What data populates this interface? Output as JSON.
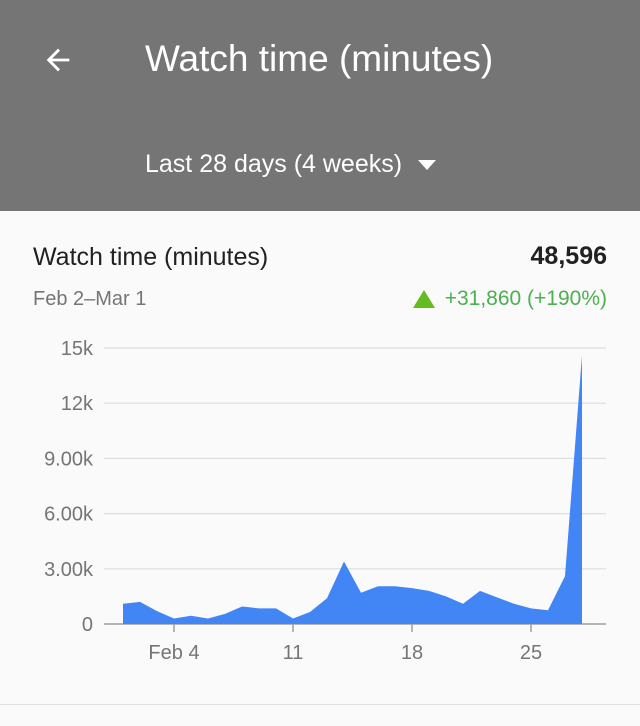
{
  "header": {
    "back_icon": "arrow-back-icon",
    "title": "Watch time (minutes)",
    "range_label": "Last 28 days (4 weeks)",
    "dropdown_icon": "caret-down-icon",
    "background": "#757575"
  },
  "metric": {
    "label": "Watch time (minutes)",
    "value": "48,596",
    "date_range": "Feb 2–Mar 1",
    "change_icon": "triangle-up-icon",
    "change": "+31,860 (+190%)",
    "change_color": "#4caf50"
  },
  "chart_data": {
    "type": "area",
    "color": "#4285f4",
    "x_ticks": [
      {
        "day": 3,
        "label": "Feb 4"
      },
      {
        "day": 10,
        "label": "11"
      },
      {
        "day": 17,
        "label": "18"
      },
      {
        "day": 24,
        "label": "25"
      }
    ],
    "y_ticks": [
      {
        "value": 0,
        "label": "0"
      },
      {
        "value": 3000,
        "label": "3.00k"
      },
      {
        "value": 6000,
        "label": "6.00k"
      },
      {
        "value": 9000,
        "label": "9.00k"
      },
      {
        "value": 12000,
        "label": "12k"
      },
      {
        "value": 15000,
        "label": "15k"
      }
    ],
    "ylim": [
      0,
      15000
    ],
    "values": [
      1100,
      1200,
      700,
      300,
      450,
      300,
      550,
      950,
      850,
      850,
      300,
      650,
      1400,
      3400,
      1700,
      2050,
      2050,
      1950,
      1800,
      1500,
      1100,
      1800,
      1450,
      1100,
      850,
      750,
      2600,
      14600
    ],
    "grid": true
  }
}
